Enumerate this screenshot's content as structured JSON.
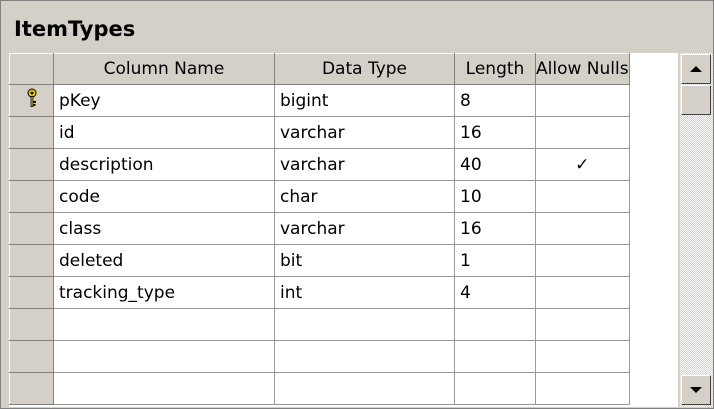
{
  "table_name": "ItemTypes",
  "columns": {
    "name": "Column Name",
    "type": "Data Type",
    "length": "Length",
    "nulls": "Allow Nulls"
  },
  "rows": [
    {
      "name": "pKey",
      "type": "bigint",
      "length": "8",
      "nulls": "",
      "key_icon": "primary-key-icon"
    },
    {
      "name": "id",
      "type": "varchar",
      "length": "16",
      "nulls": ""
    },
    {
      "name": "description",
      "type": "varchar",
      "length": "40",
      "nulls": "✓"
    },
    {
      "name": "code",
      "type": "char",
      "length": "10",
      "nulls": ""
    },
    {
      "name": "class",
      "type": "varchar",
      "length": "16",
      "nulls": ""
    },
    {
      "name": "deleted",
      "type": "bit",
      "length": "1",
      "nulls": ""
    },
    {
      "name": "tracking_type",
      "type": "int",
      "length": "4",
      "nulls": ""
    },
    {
      "name": "",
      "type": "",
      "length": "",
      "nulls": ""
    },
    {
      "name": "",
      "type": "",
      "length": "",
      "nulls": ""
    },
    {
      "name": "",
      "type": "",
      "length": "",
      "nulls": ""
    }
  ],
  "colors": {
    "panel": "#d4d0c8",
    "grid_line": "#9a9a9a",
    "key_icon": "#e6c200"
  }
}
